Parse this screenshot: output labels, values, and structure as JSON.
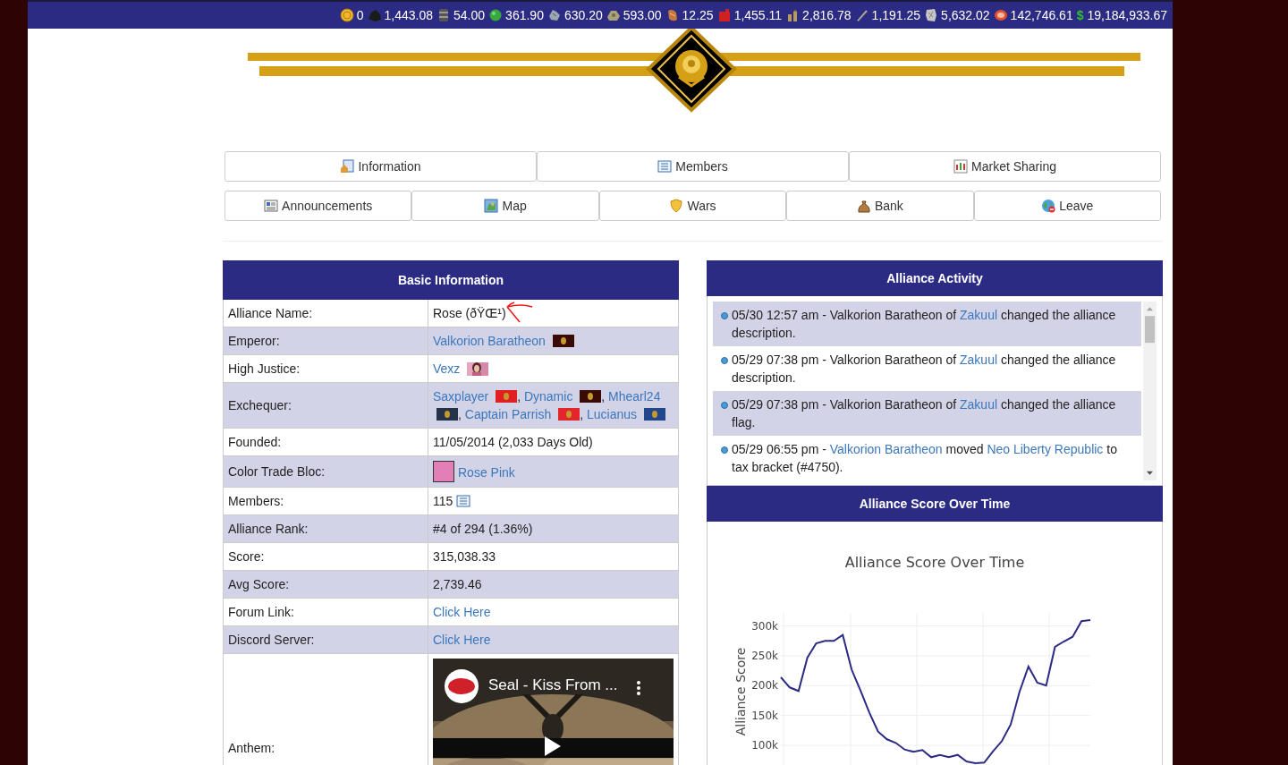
{
  "resources": [
    {
      "kind": "coin",
      "amount": "0"
    },
    {
      "kind": "coal",
      "amount": "1,443.08"
    },
    {
      "kind": "oil",
      "amount": "54.00"
    },
    {
      "kind": "uranium",
      "amount": "361.90"
    },
    {
      "kind": "iron",
      "amount": "630.20"
    },
    {
      "kind": "bauxite",
      "amount": "593.00"
    },
    {
      "kind": "lead",
      "amount": "12.25"
    },
    {
      "kind": "gasoline",
      "amount": "1,455.11"
    },
    {
      "kind": "munitions",
      "amount": "2,816.78"
    },
    {
      "kind": "steel",
      "amount": "1,191.25"
    },
    {
      "kind": "aluminum",
      "amount": "5,632.02"
    },
    {
      "kind": "food",
      "amount": "142,746.61"
    },
    {
      "kind": "money",
      "symbol": "$",
      "amount": "19,184,933.67"
    }
  ],
  "navigation": {
    "top_row": [
      {
        "label": "Information",
        "kind": "info"
      },
      {
        "label": "Members",
        "kind": "list"
      },
      {
        "label": "Market Sharing",
        "kind": "chart"
      }
    ],
    "bottom_row": [
      {
        "label": "Announcements",
        "kind": "doc"
      },
      {
        "label": "Map",
        "kind": "map"
      },
      {
        "label": "Wars",
        "kind": "shield"
      },
      {
        "label": "Bank",
        "kind": "bank"
      },
      {
        "label": "Leave",
        "kind": "globe"
      }
    ]
  },
  "basic_info": {
    "title": "Basic Information",
    "rows": [
      {
        "label": "Alliance Name:",
        "value": [
          {
            "kind": "text",
            "text": "Rose (ðŸŒ¹)"
          }
        ]
      },
      {
        "label": "Emperor:",
        "value": [
          {
            "kind": "link",
            "text": "Valkorion Baratheon"
          },
          {
            "kind": "flag",
            "color": "#3a0a05"
          }
        ]
      },
      {
        "label": "High Justice:",
        "value": [
          {
            "kind": "link",
            "text": "Vexz"
          },
          {
            "kind": "avatar"
          }
        ]
      },
      {
        "label": "Exchequer:",
        "value": [
          {
            "kind": "link",
            "text": "Saxplayer"
          },
          {
            "kind": "flag",
            "color": "#e02020"
          },
          {
            "kind": "separator",
            "text": ","
          },
          {
            "kind": "link",
            "text": "Dynamic"
          },
          {
            "kind": "flag",
            "color": "#3a0a05"
          },
          {
            "kind": "separator",
            "text": ","
          },
          {
            "kind": "link",
            "text": "Mhearl24"
          },
          {
            "kind": "flag",
            "color": "#243349"
          },
          {
            "kind": "separator",
            "text": ","
          },
          {
            "kind": "link",
            "text": "Captain Parrish"
          },
          {
            "kind": "flag",
            "color": "#e3262b"
          },
          {
            "kind": "separator",
            "text": ","
          },
          {
            "kind": "link",
            "text": "Lucianus"
          },
          {
            "kind": "flag",
            "color": "#21468b"
          }
        ]
      },
      {
        "label": "Founded:",
        "value": [
          {
            "kind": "text",
            "text": "11/05/2014 (2,033 Days Old)"
          }
        ]
      },
      {
        "label": "Color Trade Bloc:",
        "value": [
          {
            "kind": "swatch",
            "color": "#e37fb7"
          },
          {
            "kind": "link",
            "text": "Rose Pink"
          }
        ]
      },
      {
        "label": "Members:",
        "value": [
          {
            "kind": "text",
            "text": "115"
          },
          {
            "kind": "icon"
          }
        ]
      },
      {
        "label": "Alliance Rank:",
        "value": [
          {
            "kind": "text",
            "text": "#4 of 294 (1.36%)"
          }
        ]
      },
      {
        "label": "Score:",
        "value": [
          {
            "kind": "text",
            "text": "315,038.33"
          }
        ]
      },
      {
        "label": "Avg Score:",
        "value": [
          {
            "kind": "text",
            "text": "2,739.46"
          }
        ]
      },
      {
        "label": "Forum Link:",
        "value": [
          {
            "kind": "link",
            "text": "Click Here"
          }
        ]
      },
      {
        "label": "Discord Server:",
        "value": [
          {
            "kind": "link",
            "text": "Click Here"
          }
        ]
      },
      {
        "label": "Anthem:",
        "value": [
          {
            "kind": "video",
            "title": "Seal - Kiss From ..."
          }
        ]
      }
    ]
  },
  "activity": {
    "title": "Alliance Activity",
    "items": [
      {
        "segments": [
          {
            "text": "05/30 12:57 am - Valkorion Baratheon of "
          },
          {
            "text": "Zakuul",
            "link": true
          },
          {
            "text": " changed the alliance description."
          }
        ]
      },
      {
        "segments": [
          {
            "text": "05/29 07:38 pm - Valkorion Baratheon of "
          },
          {
            "text": "Zakuul",
            "link": true
          },
          {
            "text": " changed the alliance description."
          }
        ]
      },
      {
        "segments": [
          {
            "text": "05/29 07:38 pm - Valkorion Baratheon of "
          },
          {
            "text": "Zakuul",
            "link": true
          },
          {
            "text": " changed the alliance flag."
          }
        ]
      },
      {
        "segments": [
          {
            "text": "05/29 06:55 pm - "
          },
          {
            "text": "Valkorion Baratheon",
            "link": true
          },
          {
            "text": " moved "
          },
          {
            "text": "Neo Liberty Republic",
            "link": true
          },
          {
            "text": " to tax bracket (#4750)."
          }
        ]
      }
    ]
  },
  "score_panel": {
    "title": "Alliance Score Over Time",
    "chart_data": {
      "type": "line",
      "title": "Alliance Score Over Time",
      "ylabel": "Alliance Score",
      "grid": true,
      "ylim": [
        67000,
        322000
      ],
      "yticks": [
        {
          "value": 100000,
          "label": "100k"
        },
        {
          "value": 150000,
          "label": "150k"
        },
        {
          "value": 200000,
          "label": "200k"
        },
        {
          "value": 250000,
          "label": "250k"
        },
        {
          "value": 300000,
          "label": "300k"
        }
      ],
      "series": [
        {
          "color": "#2b2b84",
          "values": [
            214000,
            197000,
            191000,
            247000,
            271000,
            275000,
            275000,
            285000,
            227000,
            192000,
            155000,
            123000,
            110000,
            104000,
            93000,
            89000,
            92000,
            80000,
            84000,
            80000,
            84000,
            73000,
            70000,
            71000,
            90000,
            107000,
            135000,
            190000,
            232000,
            205000,
            200000,
            265000,
            274000,
            282000,
            308000,
            310000
          ]
        }
      ]
    }
  }
}
